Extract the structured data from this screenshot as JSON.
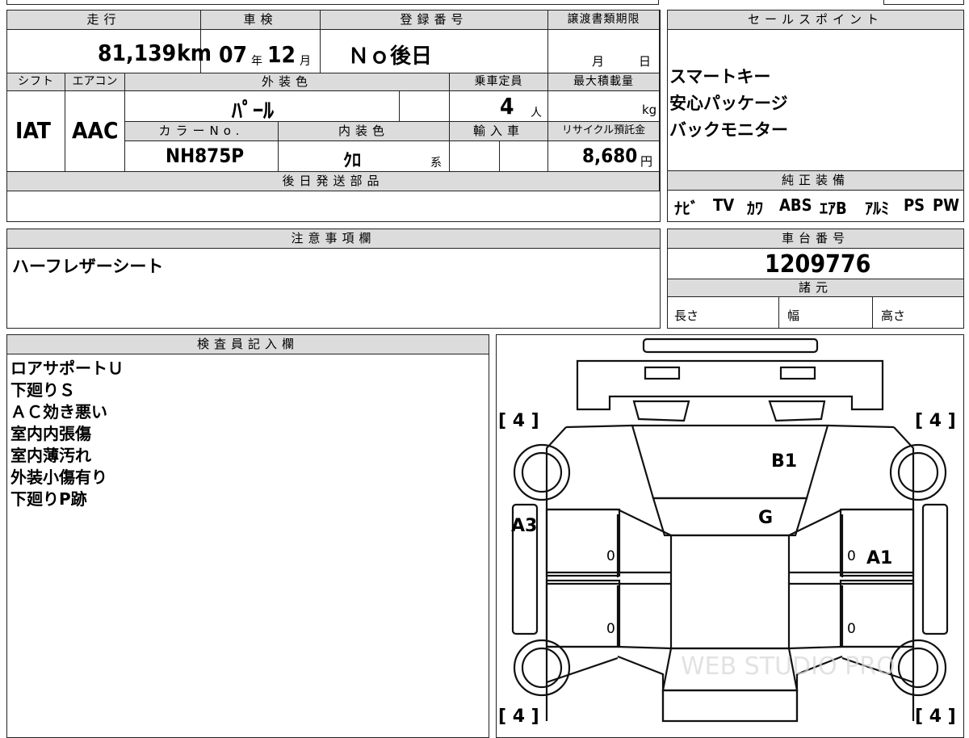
{
  "top_row": {
    "running_label": "走行",
    "inspection_label": "車検",
    "registration_label": "登録番号",
    "transfer_deadline_label": "譲渡書類期限",
    "mileage": "81,139",
    "mileage_unit": "km",
    "inspection_year": "07",
    "year_unit": "年",
    "inspection_month": "12",
    "month_unit": "月",
    "registration_value": "Ｎｏ後日",
    "deadline_month": "月",
    "deadline_day": "日"
  },
  "mid_row": {
    "shift_label": "シフト",
    "aircon_label": "エアコン",
    "exterior_color_label": "外装色",
    "capacity_label": "乗車定員",
    "max_load_label": "最大積載量",
    "shift_value": "IAT",
    "aircon_value": "AAC",
    "exterior_color_value": "ﾊﾟｰﾙ",
    "capacity_value": "4",
    "capacity_unit": "人",
    "load_unit": "kg",
    "color_no_label": "カラーNo.",
    "interior_color_label": "内装色",
    "import_label": "輸入車",
    "recycle_label": "リサイクル預託金",
    "color_no_value": "NH875P",
    "interior_color_value": "ｸﾛ",
    "interior_color_suffix": "系",
    "recycle_value": "8,680",
    "recycle_unit": "円"
  },
  "later_parts": {
    "label": "後日発送部品",
    "value": ""
  },
  "sales_points": {
    "label": "セールスポイント",
    "items": [
      "スマートキー",
      "安心パッケージ",
      "バックモニター"
    ]
  },
  "genuine_equipment": {
    "label": "純正装備",
    "items": [
      "ﾅﾋﾞ",
      "TV",
      "ｶﾜ",
      "ABS",
      "ｴｱB",
      "ｱﾙﾐ",
      "PS",
      "PW"
    ]
  },
  "notes": {
    "label": "注意事項欄",
    "text": "ハーフレザーシート"
  },
  "chassis": {
    "label": "車台番号",
    "value": "1209776",
    "specs_label": "諸元",
    "length_label": "長さ",
    "width_label": "幅",
    "height_label": "高さ"
  },
  "inspector": {
    "label": "検査員記入欄",
    "lines": [
      "ロアサポートＵ",
      "下廻りＳ",
      "ＡＣ効き悪い",
      "室内内張傷",
      "室内薄汚れ",
      "外装小傷有り",
      "下廻りP跡"
    ]
  },
  "diagram": {
    "tires": [
      "[ 4 ]",
      "[ 4 ]",
      "[ 4 ]",
      "[ 4 ]"
    ],
    "marks": [
      "B1",
      "G",
      "A3",
      "A1"
    ],
    "zeros": [
      "0",
      "0",
      "0",
      "0"
    ],
    "watermark": "WEB STUDIO PRO"
  },
  "colors": {
    "header_bg": "#dcdcdc",
    "border": "#222222"
  }
}
